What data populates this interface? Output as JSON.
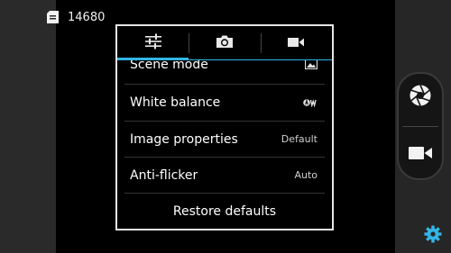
{
  "status": {
    "remaining_shots": "14680",
    "storage_icon": "sd-card-icon"
  },
  "settings_dialog": {
    "tabs": [
      {
        "icon": "sliders-icon",
        "active": true
      },
      {
        "icon": "camera-icon",
        "active": false
      },
      {
        "icon": "video-camera-icon",
        "active": false
      }
    ],
    "items": [
      {
        "label": "Scene mode",
        "value_icon": "scene-landscape-icon"
      },
      {
        "label": "White balance",
        "value_icon": "auto-white-balance-icon"
      },
      {
        "label": "Image properties",
        "value": "Default"
      },
      {
        "label": "Anti-flicker",
        "value": "Auto"
      }
    ],
    "restore_label": "Restore defaults"
  },
  "controls": {
    "shutter_icon": "shutter-aperture-icon",
    "video_icon": "video-record-icon",
    "settings_icon": "gear-icon"
  },
  "colors": {
    "accent": "#33b5e5",
    "dialog_border": "#e6e6e6"
  }
}
